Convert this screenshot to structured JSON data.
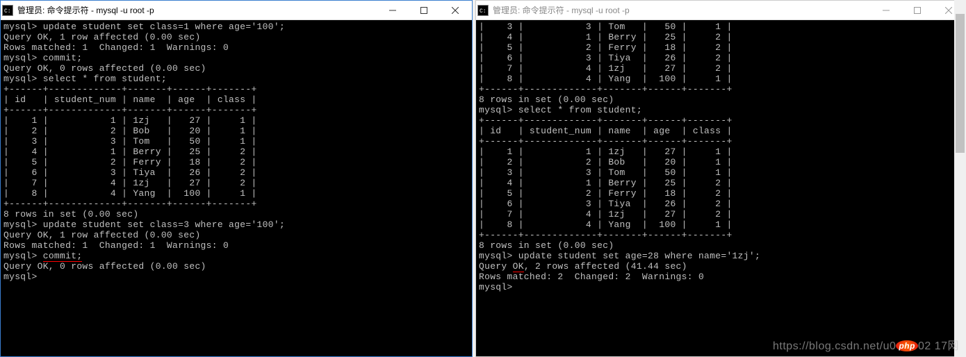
{
  "left": {
    "title": "管理员: 命令提示符 - mysql  -u root -p",
    "lines": [
      "mysql> update student set class=1 where age='100';",
      "Query OK, 1 row affected (0.00 sec)",
      "Rows matched: 1  Changed: 1  Warnings: 0",
      "",
      "mysql> commit;",
      "Query OK, 0 rows affected (0.00 sec)",
      "",
      "mysql> select * from student;"
    ],
    "table": {
      "sep": "+------+-------------+-------+------+-------+",
      "header": "| id   | student_num | name  | age  | class |",
      "rows": [
        "|    1 |           1 | 1zj   |   27 |     1 |",
        "|    2 |           2 | Bob   |   20 |     1 |",
        "|    3 |           3 | Tom   |   50 |     1 |",
        "|    4 |           1 | Berry |   25 |     2 |",
        "|    5 |           2 | Ferry |   18 |     2 |",
        "|    6 |           3 | Tiya  |   26 |     2 |",
        "|    7 |           4 | 1zj   |   27 |     2 |",
        "|    8 |           4 | Yang  |  100 |     1 |"
      ]
    },
    "after_table": [
      "8 rows in set (0.00 sec)",
      "",
      "mysql> update student set class=3 where age='100';",
      "Query OK, 1 row affected (0.00 sec)",
      "Rows matched: 1  Changed: 1  Warnings: 0",
      ""
    ],
    "commit_prompt_prefix": "mysql> ",
    "commit_word": "commit;",
    "commit_result": "Query OK, 0 rows affected (0.00 sec)",
    "final_prompt": "mysql>"
  },
  "right": {
    "title": "管理员: 命令提示符 - mysql  -u root -p",
    "top_rows": [
      "|    3 |           3 | Tom   |   50 |     1 |",
      "|    4 |           1 | Berry |   25 |     2 |",
      "|    5 |           2 | Ferry |   18 |     2 |",
      "|    6 |           3 | Tiya  |   26 |     2 |",
      "|    7 |           4 | 1zj   |   27 |     2 |",
      "|    8 |           4 | Yang  |  100 |     1 |"
    ],
    "top_sep": "+------+-------------+-------+------+-------+",
    "top_summary": "8 rows in set (0.00 sec)",
    "select_cmd": "mysql> select * from student;",
    "table": {
      "sep": "+------+-------------+-------+------+-------+",
      "header": "| id   | student_num | name  | age  | class |",
      "rows": [
        "|    1 |           1 | 1zj   |   27 |     1 |",
        "|    2 |           2 | Bob   |   20 |     1 |",
        "|    3 |           3 | Tom   |   50 |     1 |",
        "|    4 |           1 | Berry |   25 |     2 |",
        "|    5 |           2 | Ferry |   18 |     2 |",
        "|    6 |           3 | Tiya  |   26 |     2 |",
        "|    7 |           4 | 1zj   |   27 |     2 |",
        "|    8 |           4 | Yang  |  100 |     1 |"
      ]
    },
    "after_table_summary": "8 rows in set (0.00 sec)",
    "update_cmd": "mysql> update student set age=28 where name='1zj';",
    "query_ok_prefix": "Query ",
    "query_ok_word": "OK",
    "query_ok_suffix": ", 2 rows affected (41.44 sec)",
    "rows_matched": "Rows matched: 2  Changed: 2  Warnings: 0",
    "final_prompt": "mysql>"
  },
  "watermark_text": "https://blog.csdn.net/u0",
  "watermark_php": "php",
  "watermark_suffix": "02 17网"
}
